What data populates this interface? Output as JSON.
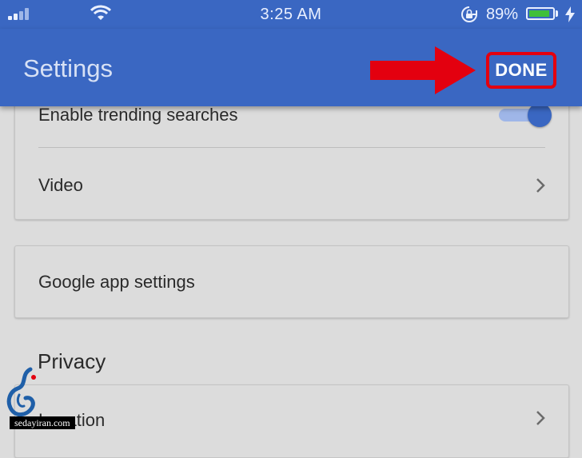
{
  "status_bar": {
    "time": "3:25 AM",
    "battery_percent": "89%",
    "battery_level": 0.89,
    "icons": [
      "signal-icon",
      "wifi-icon",
      "rotation-lock-icon",
      "battery-icon",
      "charging-bolt-icon"
    ]
  },
  "app_bar": {
    "title": "Settings",
    "done_label": "DONE"
  },
  "settings": {
    "card1": {
      "trending_label": "Enable trending searches",
      "trending_on": true,
      "video_label": "Video"
    },
    "card2": {
      "google_app_label": "Google app settings"
    },
    "privacy_header": "Privacy",
    "card3": {
      "location_label": "Location"
    }
  },
  "watermark": {
    "text": "sedayiran.com"
  },
  "colors": {
    "accent": "#3a67c2",
    "annotation_red": "#e3000f",
    "background": "#dcdcdc"
  }
}
